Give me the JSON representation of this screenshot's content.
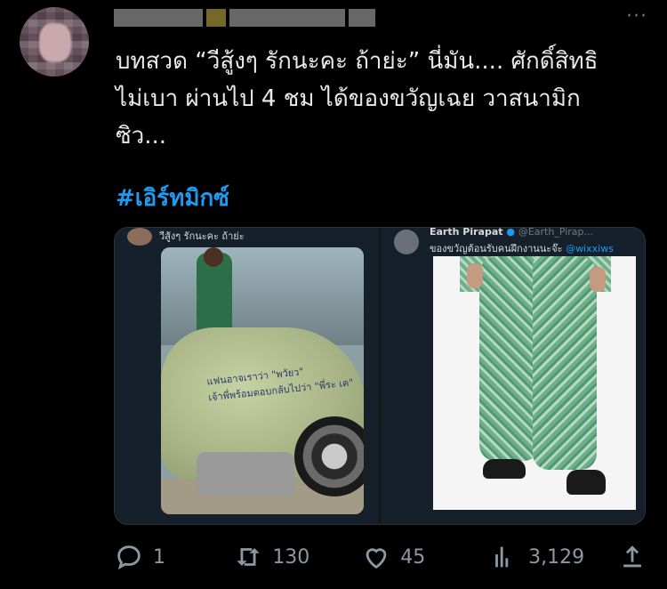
{
  "tweet": {
    "text": "บทสวด “วีสู้งๆ รักนะคะ ถ้าย่ะ” นี่มัน.... ศักดิ์สิทธิ\nไม่เบา ผ่านไป 4 ชม ได้ของขวัญเฉย วาสนามิก\nซิว...",
    "hashtag": "#เอิร์ทมิกซ์"
  },
  "media": {
    "left_caption": "วีสู้งๆ รักนะคะ ถ้าย่ะ",
    "left_writing_1": "แฟนอาจเราว่า \"พวัยว\"",
    "left_writing_2": "เจ้าพี่พร้อมตอบกลับไปว่า \"พี่ระ เค\"",
    "right_header": "Earth Pirapat",
    "right_handle": "@Earth_Pirap...",
    "right_caption": "ของขวัญต้อนรับคนฝึกงานนะจ๊ะ",
    "right_mention": "@wixxiws"
  },
  "actions": {
    "reply_count": "1",
    "retweet_count": "130",
    "like_count": "45",
    "views_count": "3,129"
  },
  "colors": {
    "background": "#000000",
    "text": "#e7e9ea",
    "link": "#1d9bf0",
    "muted": "#8b98a5"
  }
}
